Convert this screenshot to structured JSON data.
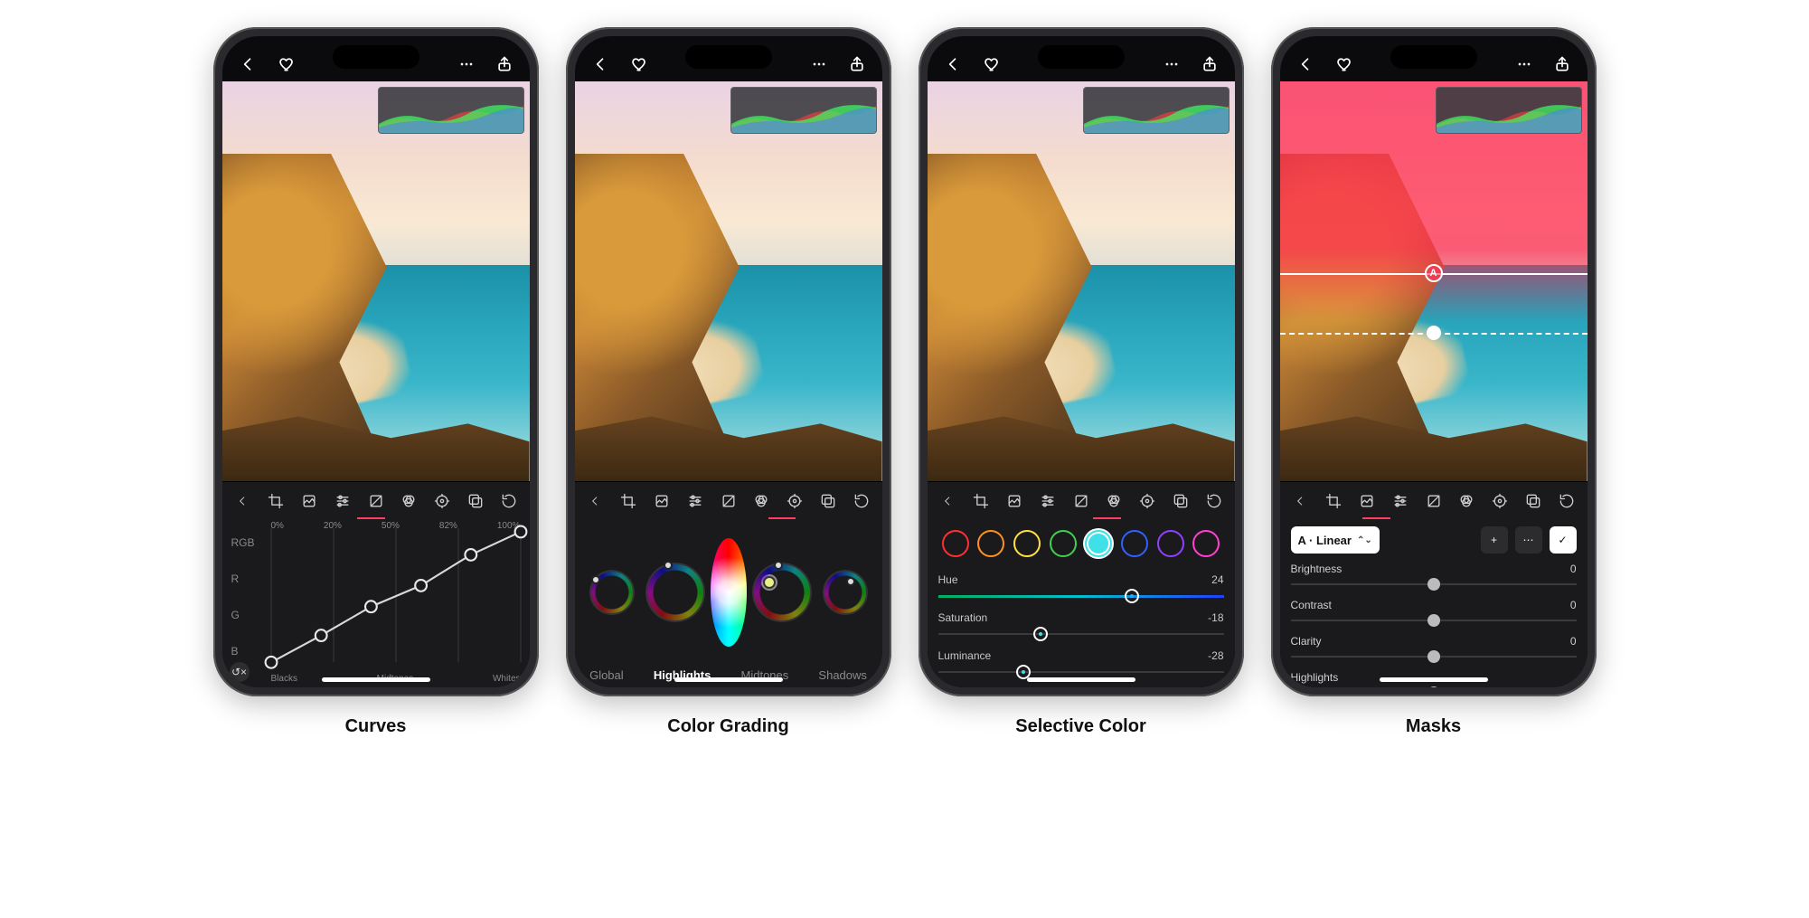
{
  "captions": [
    "Curves",
    "Color Grading",
    "Selective Color",
    "Masks"
  ],
  "topbar": {
    "back": "back",
    "heart": "favorite",
    "more": "more",
    "share": "share"
  },
  "toolstrip": {
    "items": [
      "chevron",
      "crop",
      "preset",
      "sliders",
      "exposure",
      "color",
      "grading",
      "layers",
      "history"
    ]
  },
  "curves": {
    "channels": [
      "RGB",
      "R",
      "G",
      "B"
    ],
    "percent_labels": [
      "0%",
      "20%",
      "50%",
      "82%",
      "100%"
    ],
    "zone_labels": [
      "Blacks",
      "Midtones",
      "Whites"
    ],
    "reset": "↺×"
  },
  "color_grading": {
    "tabs": [
      "Global",
      "Highlights",
      "Midtones",
      "Shadows"
    ],
    "active_tab": "Highlights"
  },
  "selective": {
    "colors": [
      "#ff3030",
      "#ff9020",
      "#ffe040",
      "#40d050",
      "#40e0e8",
      "#3060ff",
      "#9040ff",
      "#ff40d0"
    ],
    "selected_index": 4,
    "rows": [
      {
        "label": "Hue",
        "value": "24",
        "pos": 68,
        "grad": "linear-gradient(90deg,#00b060,#00c0d0,#2040ff)",
        "thumb": "#2aa8ff"
      },
      {
        "label": "Saturation",
        "value": "-18",
        "pos": 36,
        "grad": "#3a3a3e",
        "thumb": "#40e0e8"
      },
      {
        "label": "Luminance",
        "value": "-28",
        "pos": 30,
        "grad": "#3a3a3e",
        "thumb": "#40e0e8"
      }
    ]
  },
  "masks": {
    "chip_label": "A · Linear",
    "btn_add": "+",
    "btn_more": "⋯",
    "btn_confirm": "✓",
    "rows": [
      {
        "label": "Brightness",
        "value": "0",
        "pos": 50
      },
      {
        "label": "Contrast",
        "value": "0",
        "pos": 50
      },
      {
        "label": "Clarity",
        "value": "0",
        "pos": 50
      },
      {
        "label": "Highlights",
        "value": "",
        "pos": 50
      }
    ]
  }
}
